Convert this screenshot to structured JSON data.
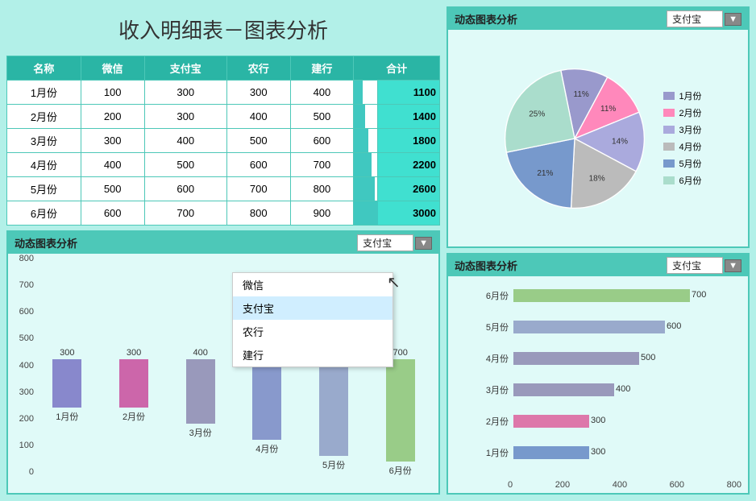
{
  "title": "收入明细表－图表分析",
  "table": {
    "headers": [
      "名称",
      "微信",
      "支付宝",
      "农行",
      "建行",
      "合计"
    ],
    "rows": [
      {
        "name": "1月份",
        "weixin": 100,
        "zhifubao": 300,
        "nongxing": 300,
        "jianxing": 400,
        "total": 1100
      },
      {
        "name": "2月份",
        "weixin": 200,
        "zhifubao": 300,
        "nongxing": 400,
        "jianxing": 500,
        "total": 1400
      },
      {
        "name": "3月份",
        "weixin": 300,
        "zhifubao": 400,
        "nongxing": 500,
        "jianxing": 600,
        "total": 1800
      },
      {
        "name": "4月份",
        "weixin": 400,
        "zhifubao": 500,
        "nongxing": 600,
        "jianxing": 700,
        "total": 2200
      },
      {
        "name": "5月份",
        "weixin": 500,
        "zhifubao": 600,
        "nongxing": 700,
        "jianxing": 800,
        "total": 2600
      },
      {
        "name": "6月份",
        "weixin": 600,
        "zhifubao": 700,
        "nongxing": 800,
        "jianxing": 900,
        "total": 3000
      }
    ]
  },
  "panels": {
    "dynamic_chart_label": "动态图表分析",
    "selected_option": "支付宝",
    "dropdown_options": [
      "微信",
      "支付宝",
      "农行",
      "建行"
    ]
  },
  "bar_chart": {
    "title": "动态图表分析",
    "selected": "支付宝",
    "y_labels": [
      "800",
      "700",
      "600",
      "500",
      "400",
      "300",
      "200",
      "100",
      "0"
    ],
    "bars": [
      {
        "label": "1月份",
        "value": 300,
        "color": "#8888cc"
      },
      {
        "label": "2月份",
        "value": 300,
        "color": "#cc66aa"
      },
      {
        "label": "3月份",
        "value": 400,
        "color": "#9999bb"
      },
      {
        "label": "4月份",
        "value": 500,
        "color": "#8899cc"
      },
      {
        "label": "5月份",
        "value": 600,
        "color": "#99aacc"
      },
      {
        "label": "6月份",
        "value": 700,
        "color": "#99cc88"
      }
    ],
    "max": 800
  },
  "pie_chart": {
    "title": "动态图表分析",
    "selected": "支付宝",
    "slices": [
      {
        "label": "1月份",
        "value": 11,
        "color": "#9999cc"
      },
      {
        "label": "2月份",
        "value": 11,
        "color": "#ff88bb"
      },
      {
        "label": "3月份",
        "value": 14,
        "color": "#aaaadd"
      },
      {
        "label": "4月份",
        "value": 18,
        "color": "#bbbbbb"
      },
      {
        "label": "5月份",
        "value": 21,
        "color": "#7799cc"
      },
      {
        "label": "6月份",
        "value": 25,
        "color": "#aaddcc"
      }
    ]
  },
  "hbar_chart": {
    "title": "动态图表分析",
    "selected": "支付宝",
    "bars": [
      {
        "label": "1月份",
        "value": 300,
        "color": "#7799cc"
      },
      {
        "label": "2月份",
        "value": 300,
        "color": "#dd77aa"
      },
      {
        "label": "3月份",
        "value": 400,
        "color": "#9999bb"
      },
      {
        "label": "4月份",
        "value": 500,
        "color": "#9999bb"
      },
      {
        "label": "5月份",
        "value": 600,
        "color": "#99aacc"
      },
      {
        "label": "6月份",
        "value": 700,
        "color": "#99cc88"
      }
    ],
    "x_labels": [
      "0",
      "200",
      "400",
      "600",
      "800"
    ],
    "max": 800
  },
  "colors": {
    "teal": "#4dc8b8",
    "bg": "#b2f0e8",
    "panel_bg": "#e0faf8",
    "header_bg": "#2ab5a5"
  }
}
